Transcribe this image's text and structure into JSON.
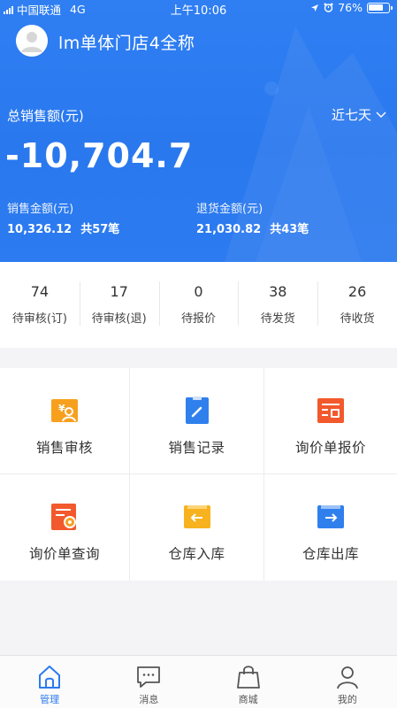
{
  "status_bar": {
    "carrier": "中国联通",
    "network": "4G",
    "time": "上午10:06",
    "battery": "76%",
    "battery_level": 0.76
  },
  "header": {
    "store_name": "lm单体门店4全称",
    "total_sales_label": "总销售额(元)",
    "period": "近七天",
    "total_sales_value": "-10,704.7",
    "sales_amount_label": "销售金额(元)",
    "sales_amount_value": "10,326.12",
    "sales_count": "共57笔",
    "return_amount_label": "退货金额(元)",
    "return_amount_value": "21,030.82",
    "return_count": "共43笔"
  },
  "counters": [
    {
      "value": "74",
      "label": "待审核(订)"
    },
    {
      "value": "17",
      "label": "待审核(退)"
    },
    {
      "value": "0",
      "label": "待报价"
    },
    {
      "value": "38",
      "label": "待发货"
    },
    {
      "value": "26",
      "label": "待收货"
    }
  ],
  "menu": [
    {
      "label": "销售审核",
      "icon": "sales-review-icon",
      "color": "#f7a01e"
    },
    {
      "label": "销售记录",
      "icon": "sales-record-icon",
      "color": "#2f80ed"
    },
    {
      "label": "询价单报价",
      "icon": "inquiry-quote-icon",
      "color": "#f2592c"
    },
    {
      "label": "询价单查询",
      "icon": "inquiry-search-icon",
      "color": "#f2592c"
    },
    {
      "label": "仓库入库",
      "icon": "warehouse-in-icon",
      "color": "#f7b21e"
    },
    {
      "label": "仓库出库",
      "icon": "warehouse-out-icon",
      "color": "#2f80ed"
    }
  ],
  "tabs": [
    {
      "label": "管理",
      "icon": "home-icon",
      "active": true
    },
    {
      "label": "消息",
      "icon": "message-icon",
      "active": false
    },
    {
      "label": "商城",
      "icon": "shopping-bag-icon",
      "active": false
    },
    {
      "label": "我的",
      "icon": "user-icon",
      "active": false
    }
  ],
  "colors": {
    "primary": "#2b7bf0",
    "header_bg": "#2f7ff3",
    "page_bg": "#f4f4f6"
  }
}
